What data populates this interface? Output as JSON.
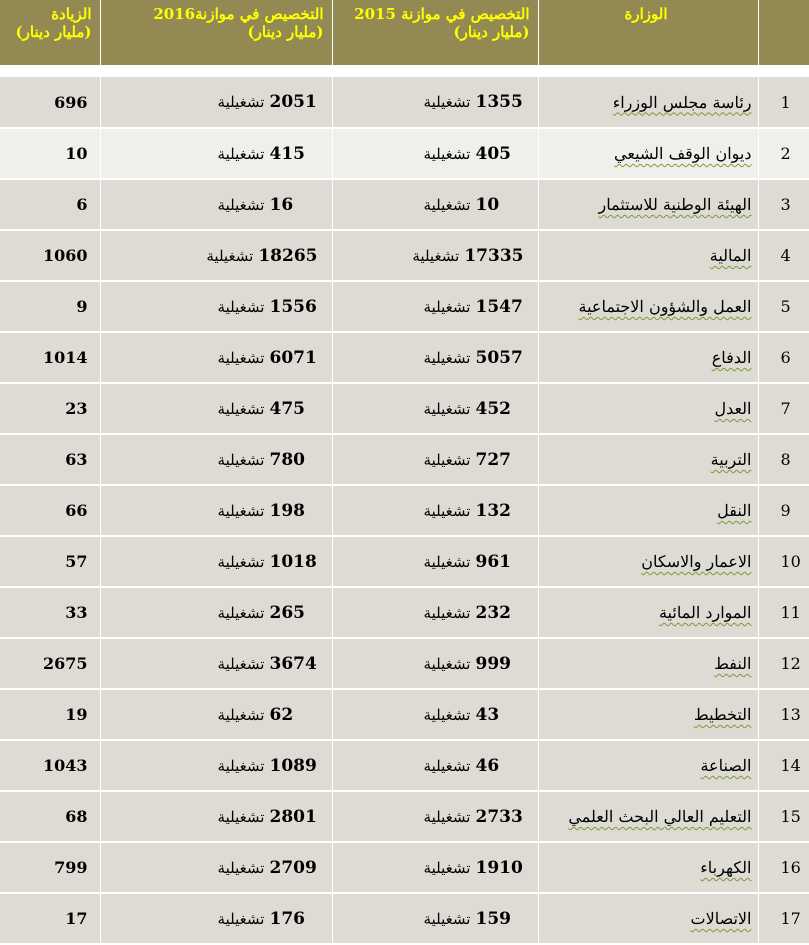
{
  "header": {
    "increase": [
      "الزيادة",
      "(مليار دينار)"
    ],
    "alloc2016": [
      "التخصيص في موازنة2016",
      "(مليار دينار)"
    ],
    "alloc2015": [
      "التخصيص في موازنة 2015",
      "(مليار دينار)"
    ],
    "ministry": "الوزارة",
    "index": ""
  },
  "rows": [
    {
      "n": "1",
      "ministry": "رئاسة مجلس الوزراء",
      "v2015": "1355",
      "t2015": "تشغيلية",
      "v2016": "2051",
      "t2016": "تشغيلية",
      "inc": "696"
    },
    {
      "n": "2",
      "ministry": "ديوان الوقف الشيعي",
      "v2015": "405",
      "t2015": "تشغيلية",
      "v2016": "415",
      "t2016": "تشغيلية",
      "inc": "10"
    },
    {
      "n": "3",
      "ministry": "الهيئة الوطنية للاستثمار",
      "v2015": "10",
      "t2015": "تشغيلية",
      "v2016": "16",
      "t2016": "تشغيلية",
      "inc": "6"
    },
    {
      "n": "4",
      "ministry": "المالية",
      "v2015": "17335",
      "t2015": "تشغيلية",
      "v2016": "18265",
      "t2016": "تشغيلية",
      "inc": "1060"
    },
    {
      "n": "5",
      "ministry": "العمل والشؤون الاجتماعية",
      "v2015": "1547",
      "t2015": "تشغيلية",
      "v2016": "1556",
      "t2016": "تشغيلية",
      "inc": "9"
    },
    {
      "n": "6",
      "ministry": "الدفاع",
      "v2015": "5057",
      "t2015": "تشغيلية",
      "v2016": "6071",
      "t2016": "تشغيلية",
      "inc": "1014"
    },
    {
      "n": "7",
      "ministry": "العدل",
      "v2015": "452",
      "t2015": "تشغيلية",
      "v2016": "475",
      "t2016": "تشغيلية",
      "inc": "23"
    },
    {
      "n": "8",
      "ministry": "التربية",
      "v2015": "727",
      "t2015": "تشغيلية",
      "v2016": "780",
      "t2016": "تشغيلية",
      "inc": "63"
    },
    {
      "n": "9",
      "ministry": "النقل",
      "v2015": "132",
      "t2015": "تشغيلية",
      "v2016": "198",
      "t2016": "تشغيلية",
      "inc": "66"
    },
    {
      "n": "10",
      "ministry": "الاعمار والاسكان",
      "v2015": "961",
      "t2015": "تشغيلية",
      "v2016": "1018",
      "t2016": "تشغيلية",
      "inc": "57"
    },
    {
      "n": "11",
      "ministry": "الموارد المائية",
      "v2015": "232",
      "t2015": "تشغيلية",
      "v2016": "265",
      "t2016": "تشغيلية",
      "inc": "33"
    },
    {
      "n": "12",
      "ministry": "النفط",
      "v2015": "999",
      "t2015": "تشغيلية",
      "v2016": "3674",
      "t2016": "تشغيلية",
      "inc": "2675"
    },
    {
      "n": "13",
      "ministry": "التخطيط",
      "v2015": "43",
      "t2015": "تشغيلية",
      "v2016": "62",
      "t2016": "تشغيلية",
      "inc": "19"
    },
    {
      "n": "14",
      "ministry": "الصناعة",
      "v2015": "46",
      "t2015": "تشغيلية",
      "v2016": "1089",
      "t2016": "تشغيلية",
      "inc": "1043"
    },
    {
      "n": "15",
      "ministry": "التعليم العالي البحث العلمي",
      "v2015": "2733",
      "t2015": "تشغيلية",
      "v2016": "2801",
      "t2016": "تشغيلية",
      "inc": "68"
    },
    {
      "n": "16",
      "ministry": "الكهرباء",
      "v2015": "1910",
      "t2015": "تشغيلية",
      "v2016": "2709",
      "t2016": "تشغيلية",
      "inc": "799"
    },
    {
      "n": "17",
      "ministry": "الاتصالات",
      "v2015": "159",
      "t2015": "تشغيلية",
      "v2016": "176",
      "t2016": "تشغيلية",
      "inc": "17"
    }
  ],
  "colors": {
    "header_bg": "#938953",
    "header_text": "#ffff00",
    "row_bg": "#dedbd4",
    "highlight_row_bg": "#f1efec"
  },
  "highlighted_row": 2
}
